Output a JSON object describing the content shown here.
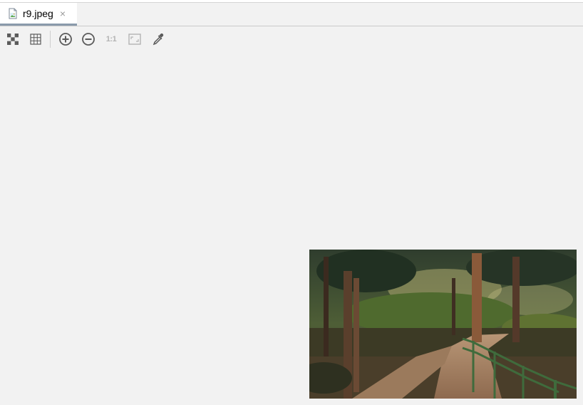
{
  "tab": {
    "filename": "r9.jpeg",
    "close_glyph": "×",
    "icon": "image-file-icon"
  },
  "toolbar": {
    "items": [
      {
        "icon": "chessboard-background-icon"
      },
      {
        "icon": "grid-icon"
      },
      {
        "icon": "zoom-in-icon"
      },
      {
        "icon": "zoom-out-icon"
      },
      {
        "icon": "actual-size-icon",
        "label": "1:1"
      },
      {
        "icon": "fit-zoom-icon"
      },
      {
        "icon": "color-picker-icon"
      }
    ]
  },
  "colors": {
    "background": "#f2f2f2",
    "tab_active_underline": "#8a9aab",
    "icon_active": "#5b5b5b",
    "icon_disabled": "#b3b3b3"
  }
}
